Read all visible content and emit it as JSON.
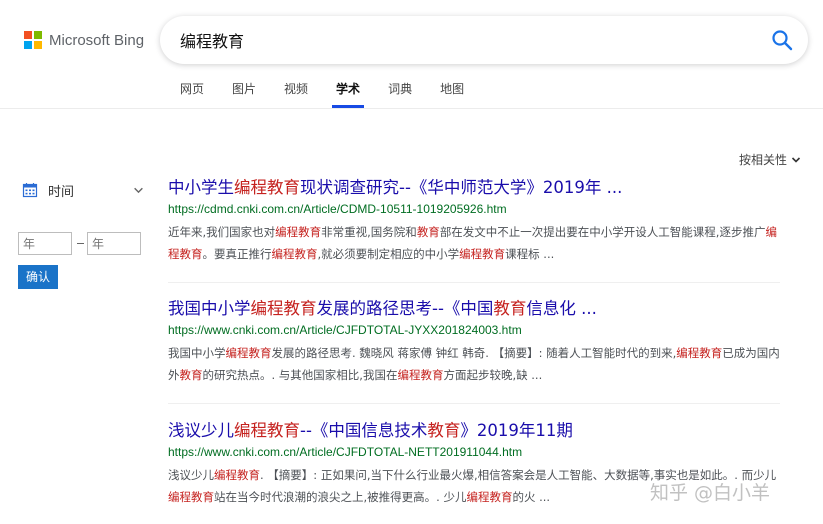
{
  "brand": {
    "name": "Microsoft Bing",
    "logo_colors": [
      "#f25022",
      "#7fba00",
      "#00a4ef",
      "#ffb900"
    ]
  },
  "search": {
    "query": "编程教育",
    "icon": "search-icon"
  },
  "tabs": [
    {
      "label": "网页",
      "active": false
    },
    {
      "label": "图片",
      "active": false
    },
    {
      "label": "视频",
      "active": false
    },
    {
      "label": "学术",
      "active": true
    },
    {
      "label": "词典",
      "active": false
    },
    {
      "label": "地图",
      "active": false
    }
  ],
  "sort": {
    "label": "按相关性"
  },
  "filter": {
    "time_label": "时间",
    "from_placeholder": "年",
    "to_placeholder": "年",
    "confirm_label": "确认"
  },
  "results": [
    {
      "title": [
        {
          "t": "中小学生",
          "hl": false
        },
        {
          "t": "编程教育",
          "hl": true
        },
        {
          "t": "现状调查研究--《华中师范大学》2019年 ...",
          "hl": false
        }
      ],
      "url": "https://cdmd.cnki.com.cn/Article/CDMD-10511-1019205926.htm",
      "snippet": [
        {
          "t": "近年来,我们国家也对",
          "hl": false
        },
        {
          "t": "编程教育",
          "hl": true
        },
        {
          "t": "非常重视,国务院和",
          "hl": false
        },
        {
          "t": "教育",
          "hl": true
        },
        {
          "t": "部在发文中不止一次提出要在中小学开设人工智能课程,逐步推广",
          "hl": false
        },
        {
          "t": "编程教育",
          "hl": true
        },
        {
          "t": "。要真正推行",
          "hl": false
        },
        {
          "t": "编程教育",
          "hl": true
        },
        {
          "t": ",就必须要制定相应的中小学",
          "hl": false
        },
        {
          "t": "编程教育",
          "hl": true
        },
        {
          "t": "课程标 ...",
          "hl": false
        }
      ]
    },
    {
      "title": [
        {
          "t": "我国中小学",
          "hl": false
        },
        {
          "t": "编程教育",
          "hl": true
        },
        {
          "t": "发展的路径思考--《中国",
          "hl": false
        },
        {
          "t": "教育",
          "hl": true
        },
        {
          "t": "信息化 ...",
          "hl": false
        }
      ],
      "url": "https://www.cnki.com.cn/Article/CJFDTOTAL-JYXX201824003.htm",
      "snippet": [
        {
          "t": "我国中小学",
          "hl": false
        },
        {
          "t": "编程教育",
          "hl": true
        },
        {
          "t": "发展的路径思考. 魏晓风 蒋家傅 钟红 韩奇. 【摘要】: 随着人工智能时代的到来,",
          "hl": false
        },
        {
          "t": "编程教育",
          "hl": true
        },
        {
          "t": "已成为国内外",
          "hl": false
        },
        {
          "t": "教育",
          "hl": true
        },
        {
          "t": "的研究热点。. 与其他国家相比,我国在",
          "hl": false
        },
        {
          "t": "编程教育",
          "hl": true
        },
        {
          "t": "方面起步较晚,缺 ...",
          "hl": false
        }
      ]
    },
    {
      "title": [
        {
          "t": "浅议少儿",
          "hl": false
        },
        {
          "t": "编程教育",
          "hl": true
        },
        {
          "t": "--《中国信息技术",
          "hl": false
        },
        {
          "t": "教育",
          "hl": true
        },
        {
          "t": "》2019年11期",
          "hl": false
        }
      ],
      "url": "https://www.cnki.com.cn/Article/CJFDTOTAL-NETT201911044.htm",
      "snippet": [
        {
          "t": "浅议少儿",
          "hl": false
        },
        {
          "t": "编程教育",
          "hl": true
        },
        {
          "t": ". 【摘要】: 正如果问,当下什么行业最火爆,相信答案会是人工智能、大数据等,事实也是如此。. 而少儿",
          "hl": false
        },
        {
          "t": "编程教育",
          "hl": true
        },
        {
          "t": "站在当今时代浪潮的浪尖之上,被推得更高。. 少儿",
          "hl": false
        },
        {
          "t": "编程教育",
          "hl": true
        },
        {
          "t": "的火 ...",
          "hl": false
        }
      ]
    }
  ],
  "watermark": "知乎 @白小羊",
  "colors": {
    "link": "#1a0dab",
    "url": "#006d21",
    "highlight": "#c5221f",
    "accent": "#174ae4",
    "button": "#1a73c8"
  }
}
